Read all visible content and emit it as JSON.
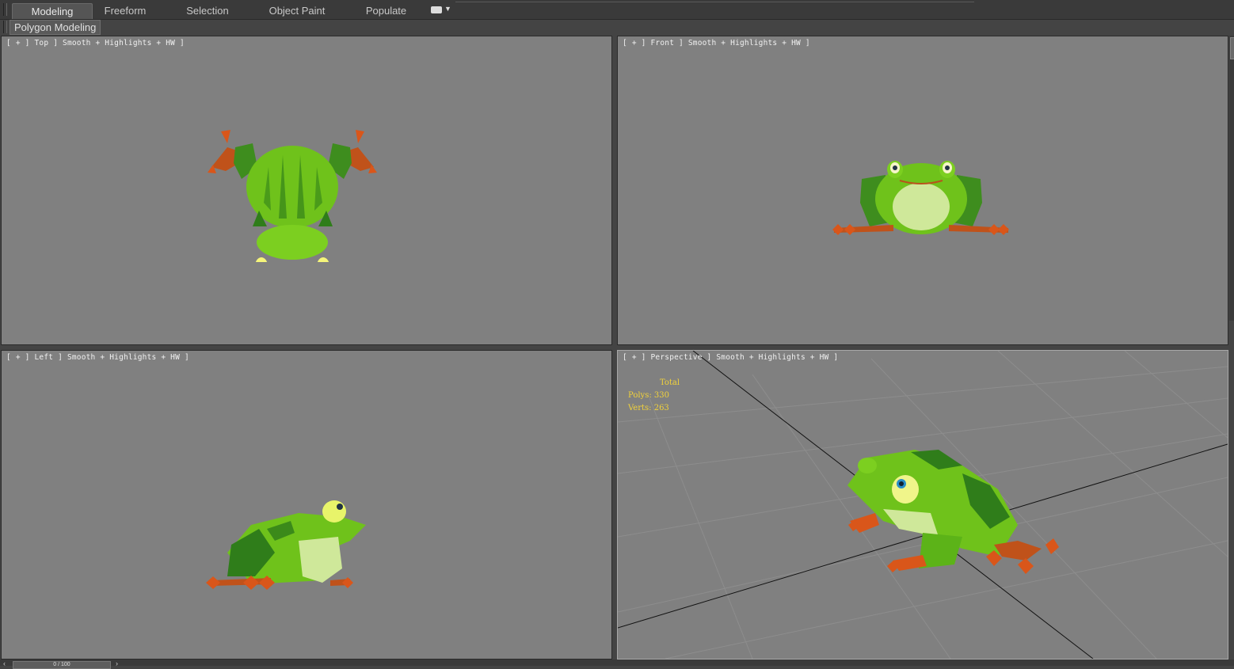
{
  "ribbon": {
    "tabs": [
      {
        "label": "Modeling",
        "active": true
      },
      {
        "label": "Freeform",
        "active": false
      },
      {
        "label": "Selection",
        "active": false
      },
      {
        "label": "Object Paint",
        "active": false
      },
      {
        "label": "Populate",
        "active": false
      }
    ],
    "options_icon": "ribbon-options-icon"
  },
  "subribbon": {
    "panel_label": "Polygon Modeling"
  },
  "viewports": {
    "top": {
      "label": "[ + ] Top ] Smooth + Highlights + HW ]"
    },
    "front": {
      "label": "[ + ] Front ] Smooth + Highlights + HW ]"
    },
    "left": {
      "label": "[ + ] Left ] Smooth + Highlights + HW ]"
    },
    "persp": {
      "label": "[ + ] Perspective ] Smooth + Highlights + HW ]"
    }
  },
  "stats": {
    "title": "Total",
    "polys": "Polys: 330",
    "verts": "Verts: 263"
  },
  "timeslider": {
    "value": "0 / 100"
  },
  "colors": {
    "viewport_bg": "#808080",
    "ui_bg": "#444444",
    "frog_green": "#6fc21b",
    "frog_dark": "#2f7d1a",
    "frog_belly": "#cfe89a",
    "toe_orange": "#d9561a",
    "stats_yellow": "#f2d23a"
  }
}
